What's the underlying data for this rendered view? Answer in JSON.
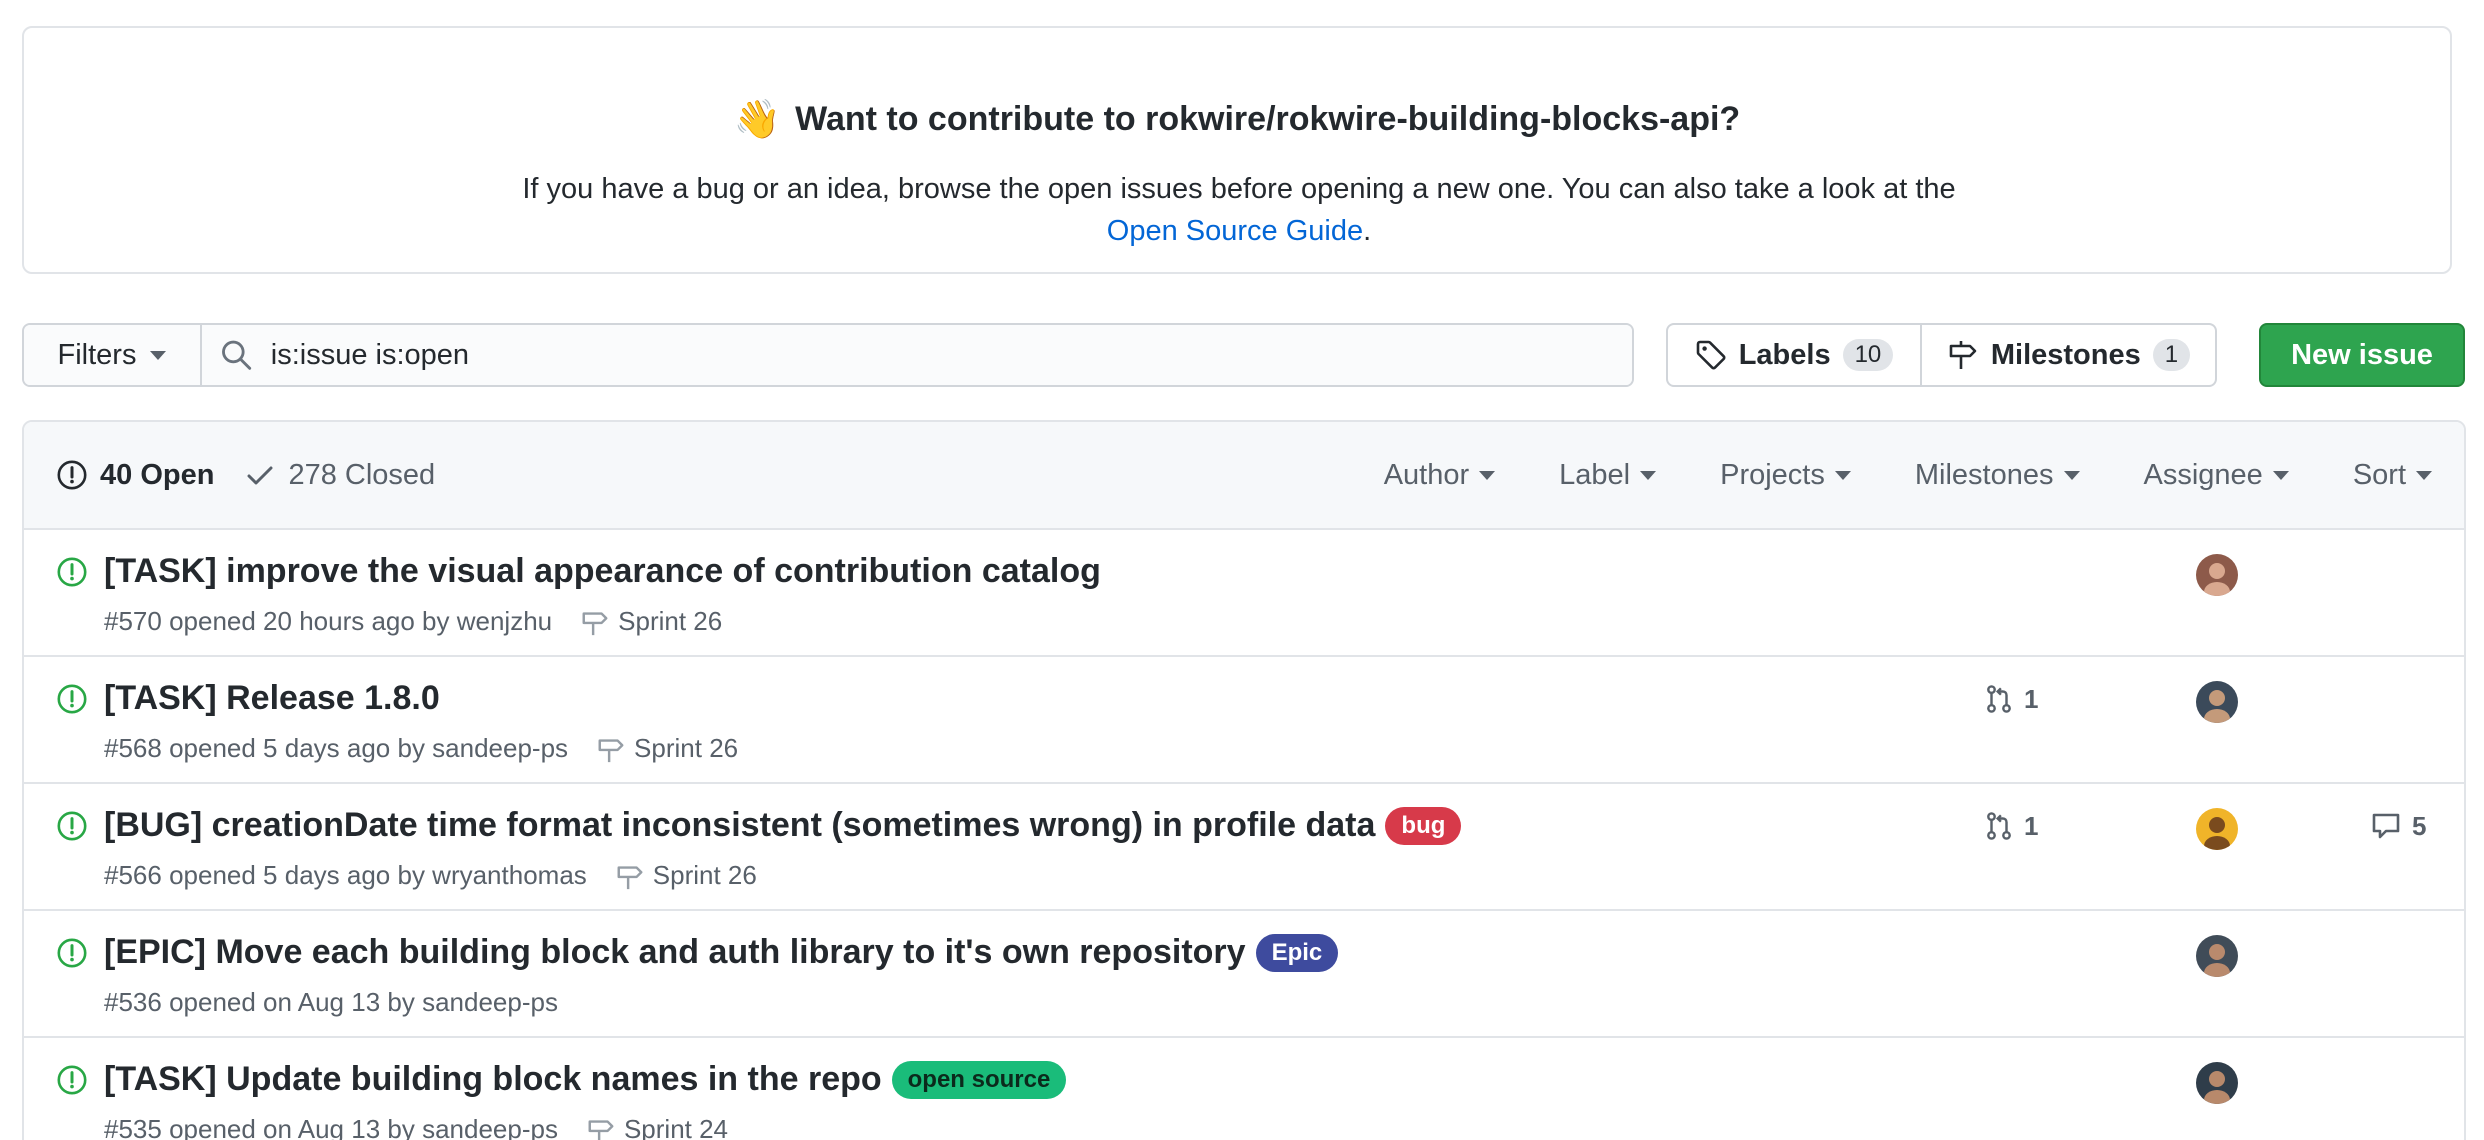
{
  "banner": {
    "emoji": "👋",
    "title": "Want to contribute to rokwire/rokwire-building-blocks-api?",
    "text_before": "If you have a bug or an idea, browse the open issues before opening a new one. You can also take a look at the ",
    "link_text": "Open Source Guide",
    "text_after": "."
  },
  "toolbar": {
    "filters_label": "Filters",
    "search_value": "is:issue is:open",
    "labels_label": "Labels",
    "labels_count": "10",
    "milestones_label": "Milestones",
    "milestones_count": "1",
    "new_issue_label": "New issue"
  },
  "header": {
    "open_label": "40 Open",
    "closed_label": "278 Closed",
    "filters": [
      "Author",
      "Label",
      "Projects",
      "Milestones",
      "Assignee",
      "Sort"
    ]
  },
  "colors": {
    "open_green": "#28a745",
    "bug": "#d73a4a",
    "epic": "#3e4b9e",
    "open_source": "#1abc7a",
    "new_issue_green": "#2ea44f"
  },
  "issues": [
    {
      "title": "[TASK] improve the visual appearance of contribution catalog",
      "meta": "#570 opened 20 hours ago by wenjzhu",
      "milestone": "Sprint 26",
      "label": "",
      "pr_count": "",
      "comments": ""
    },
    {
      "title": "[TASK] Release 1.8.0",
      "meta": "#568 opened 5 days ago by sandeep-ps",
      "milestone": "Sprint 26",
      "label": "",
      "pr_count": "1",
      "comments": ""
    },
    {
      "title": "[BUG] creationDate time format inconsistent (sometimes wrong) in profile data",
      "meta": "#566 opened 5 days ago by wryanthomas",
      "milestone": "Sprint 26",
      "label": "bug",
      "pr_count": "1",
      "comments": "5"
    },
    {
      "title": "[EPIC] Move each building block and auth library to it's own repository",
      "meta": "#536 opened on Aug 13 by sandeep-ps",
      "milestone": "",
      "label": "Epic",
      "pr_count": "",
      "comments": ""
    },
    {
      "title": "[TASK] Update building block names in the repo",
      "meta": "#535 opened on Aug 13 by sandeep-ps",
      "milestone": "Sprint 24",
      "label": "open source",
      "pr_count": "",
      "comments": ""
    }
  ]
}
